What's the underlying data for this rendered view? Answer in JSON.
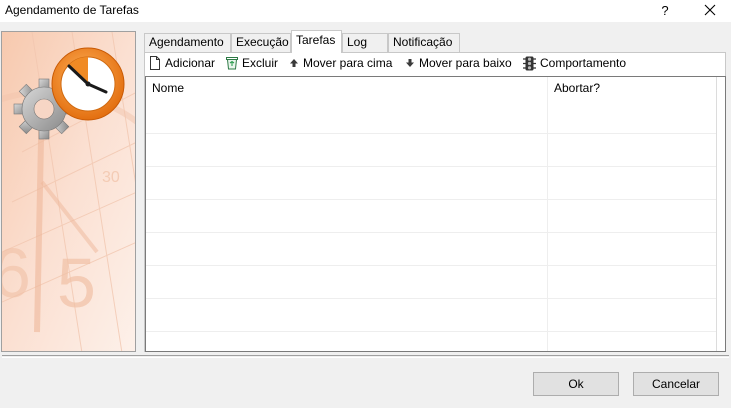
{
  "window": {
    "title": "Agendamento de Tarefas",
    "help_label": "?",
    "close_label": "✕"
  },
  "tabs": [
    {
      "label": "Agendamento",
      "active": false
    },
    {
      "label": "Execução",
      "active": false
    },
    {
      "label": "Tarefas",
      "active": true
    },
    {
      "label": "Log",
      "active": false
    },
    {
      "label": "Notificação",
      "active": false
    }
  ],
  "toolbar": {
    "add_label": "Adicionar",
    "delete_label": "Excluir",
    "move_up_label": "Mover para cima",
    "move_down_label": "Mover para baixo",
    "behavior_label": "Comportamento"
  },
  "grid": {
    "columns": [
      "Nome",
      "Abortar?"
    ],
    "rows": []
  },
  "buttons": {
    "ok_label": "Ok",
    "cancel_label": "Cancelar"
  },
  "colors": {
    "banner_bg": "#fbe3d6",
    "clock_orange": "#f08a24"
  },
  "icons": {
    "banner": "clock-gear-icon",
    "add": "new-document-icon",
    "delete": "recycle-bin-icon",
    "move_up": "arrow-up-icon",
    "move_down": "arrow-down-icon",
    "behavior": "traffic-light-icon"
  }
}
